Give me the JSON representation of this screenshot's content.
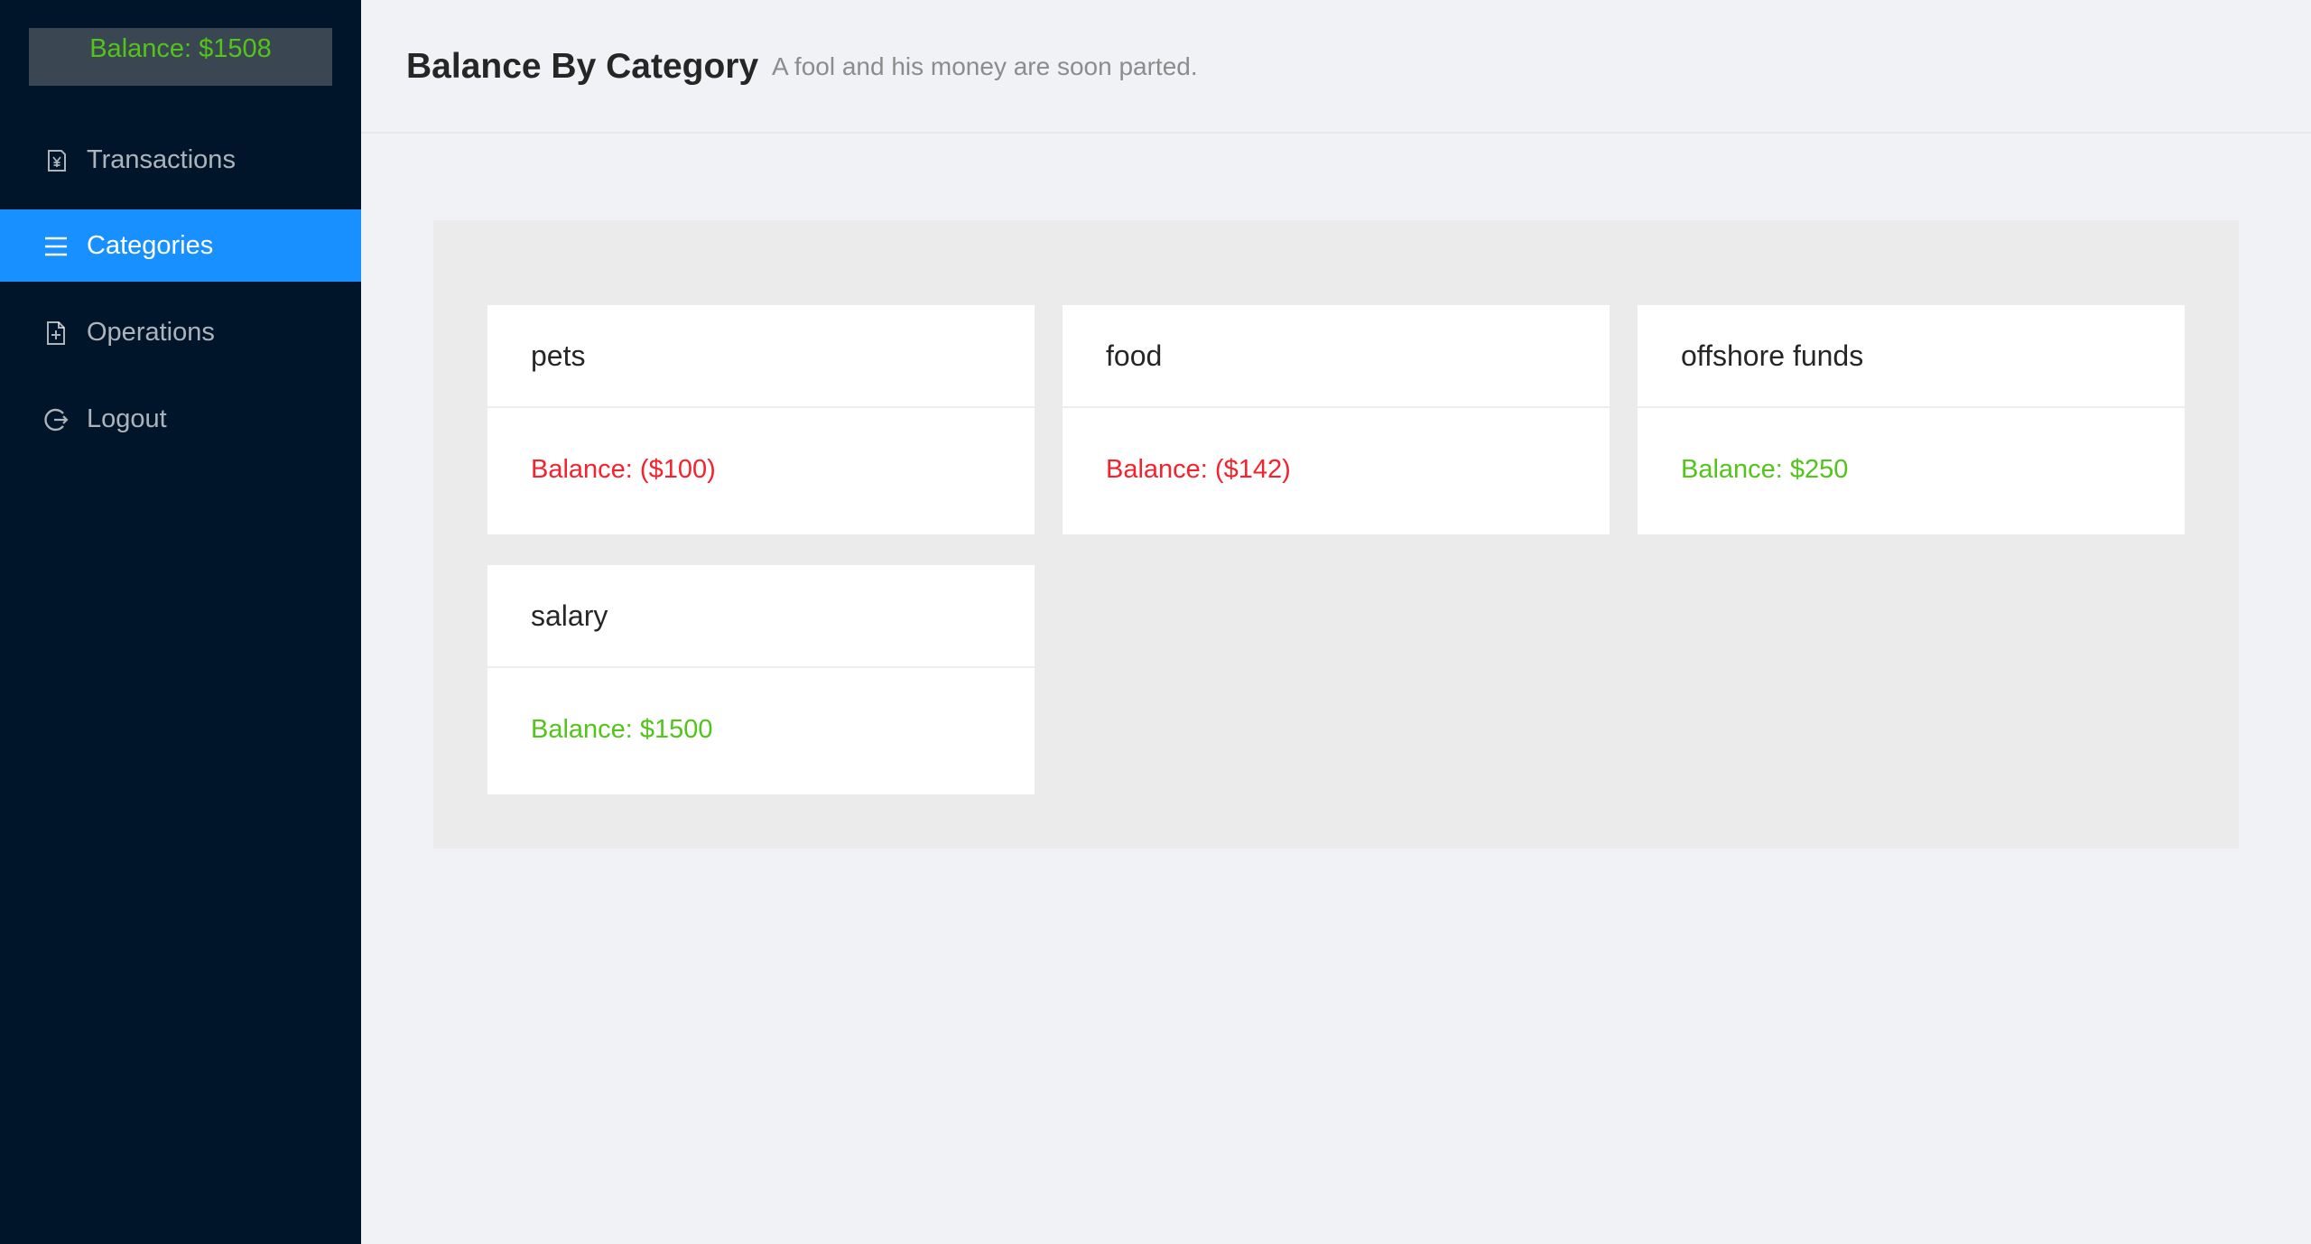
{
  "sidebar": {
    "balance_label": "Balance: $1508",
    "items": [
      {
        "label": "Transactions",
        "icon": "yen-document-icon",
        "active": false
      },
      {
        "label": "Categories",
        "icon": "menu-icon",
        "active": true
      },
      {
        "label": "Operations",
        "icon": "file-add-icon",
        "active": false
      },
      {
        "label": "Logout",
        "icon": "logout-icon",
        "active": false
      }
    ]
  },
  "header": {
    "title": "Balance By Category",
    "subtitle": "A fool and his money are soon parted."
  },
  "categories": [
    {
      "name": "pets",
      "balance": "Balance: ($100)",
      "status": "negative"
    },
    {
      "name": "food",
      "balance": "Balance: ($142)",
      "status": "negative"
    },
    {
      "name": "offshore funds",
      "balance": "Balance: $250",
      "status": "positive"
    },
    {
      "name": "salary",
      "balance": "Balance: $1500",
      "status": "positive"
    }
  ],
  "colors": {
    "sidebar_bg": "#001529",
    "active_item": "#1890ff",
    "positive": "#52c41a",
    "negative": "#f5222d"
  }
}
